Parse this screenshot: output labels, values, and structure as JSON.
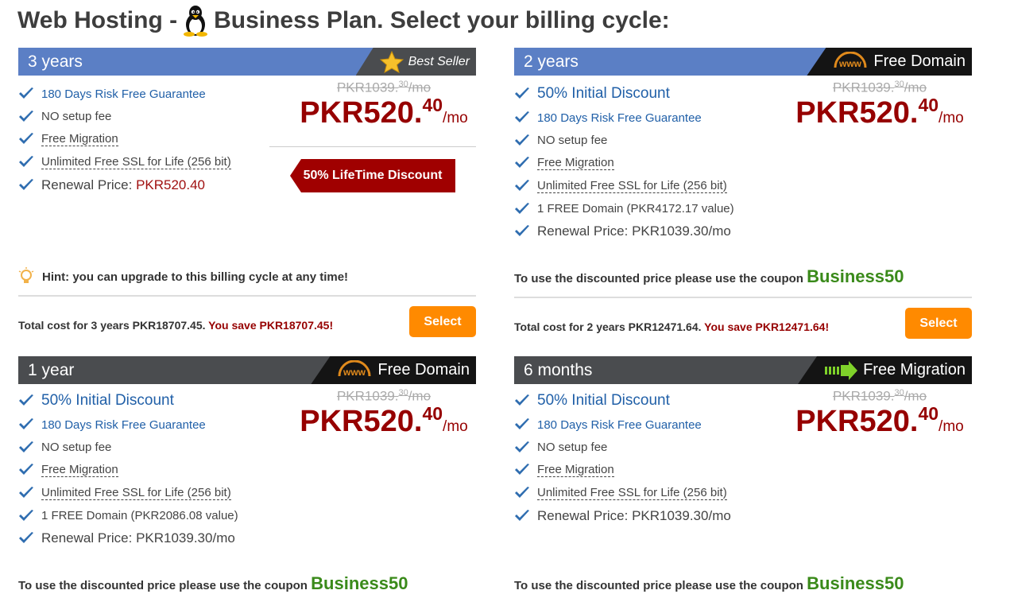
{
  "page": {
    "title_prefix": "Web Hosting -",
    "title_suffix": "Business Plan. Select your billing cycle:"
  },
  "plans": [
    {
      "cycle": "3 years",
      "badge": "Best Seller",
      "features": [
        "180 Days Risk Free Guarantee",
        "NO setup fee",
        "Free Migration",
        "Unlimited Free SSL for Life (256 bit)"
      ],
      "renewal_label": "Renewal Price:",
      "renewal_value": "PKR520.40",
      "old_price_main": "PKR1039.",
      "old_price_cents": "30",
      "old_price_unit": "/mo",
      "price_main": "PKR520.",
      "price_cents": "40",
      "price_unit": "/mo",
      "ribbon": "50% LifeTime Discount",
      "hint": "Hint: you can upgrade to this billing cycle at any time!",
      "total_text": "Total cost for 3 years PKR18707.45.",
      "save_text": "You save PKR18707.45!",
      "select_label": "Select"
    },
    {
      "cycle": "2 years",
      "badge": "Free Domain",
      "initial_discount": "50% Initial Discount",
      "features": [
        "180 Days Risk Free Guarantee",
        "NO setup fee",
        "Free Migration",
        "Unlimited Free SSL for Life (256 bit)",
        "1 FREE Domain (PKR4172.17 value)"
      ],
      "renewal_label": "Renewal Price:",
      "renewal_value": "PKR1039.30/mo",
      "old_price_main": "PKR1039.",
      "old_price_cents": "30",
      "old_price_unit": "/mo",
      "price_main": "PKR520.",
      "price_cents": "40",
      "price_unit": "/mo",
      "coupon_text": "To use the discounted price please use the coupon",
      "coupon_code": "Business50",
      "total_text": "Total cost for 2 years PKR12471.64.",
      "save_text": "You save PKR12471.64!",
      "select_label": "Select"
    },
    {
      "cycle": "1 year",
      "badge": "Free Domain",
      "initial_discount": "50% Initial Discount",
      "features": [
        "180 Days Risk Free Guarantee",
        "NO setup fee",
        "Free Migration",
        "Unlimited Free SSL for Life (256 bit)",
        "1 FREE Domain (PKR2086.08 value)"
      ],
      "renewal_label": "Renewal Price:",
      "renewal_value": "PKR1039.30/mo",
      "old_price_main": "PKR1039.",
      "old_price_cents": "30",
      "old_price_unit": "/mo",
      "price_main": "PKR520.",
      "price_cents": "40",
      "price_unit": "/mo",
      "coupon_text": "To use the discounted price please use the coupon",
      "coupon_code": "Business50"
    },
    {
      "cycle": "6 months",
      "badge": "Free Migration",
      "initial_discount": "50% Initial Discount",
      "features": [
        "180 Days Risk Free Guarantee",
        "NO setup fee",
        "Free Migration",
        "Unlimited Free SSL for Life (256 bit)"
      ],
      "renewal_label": "Renewal Price:",
      "renewal_value": "PKR1039.30/mo",
      "old_price_main": "PKR1039.",
      "old_price_cents": "30",
      "old_price_unit": "/mo",
      "price_main": "PKR520.",
      "price_cents": "40",
      "price_unit": "/mo",
      "coupon_text": "To use the discounted price please use the coupon",
      "coupon_code": "Business50"
    }
  ],
  "colors": {
    "header_blue": "#5b7fc5",
    "header_gray": "#4a4c4f",
    "price_red": "#960000",
    "coupon_green": "#3a8a1a",
    "select_orange": "#ff8a00",
    "link_blue": "#2160a8"
  },
  "icons": {
    "title": "linux-tux-icon",
    "check": "check-icon",
    "best_seller": "star-icon",
    "free_domain": "www-icon",
    "free_migration": "migration-arrow-icon",
    "hint": "lightbulb-icon"
  }
}
